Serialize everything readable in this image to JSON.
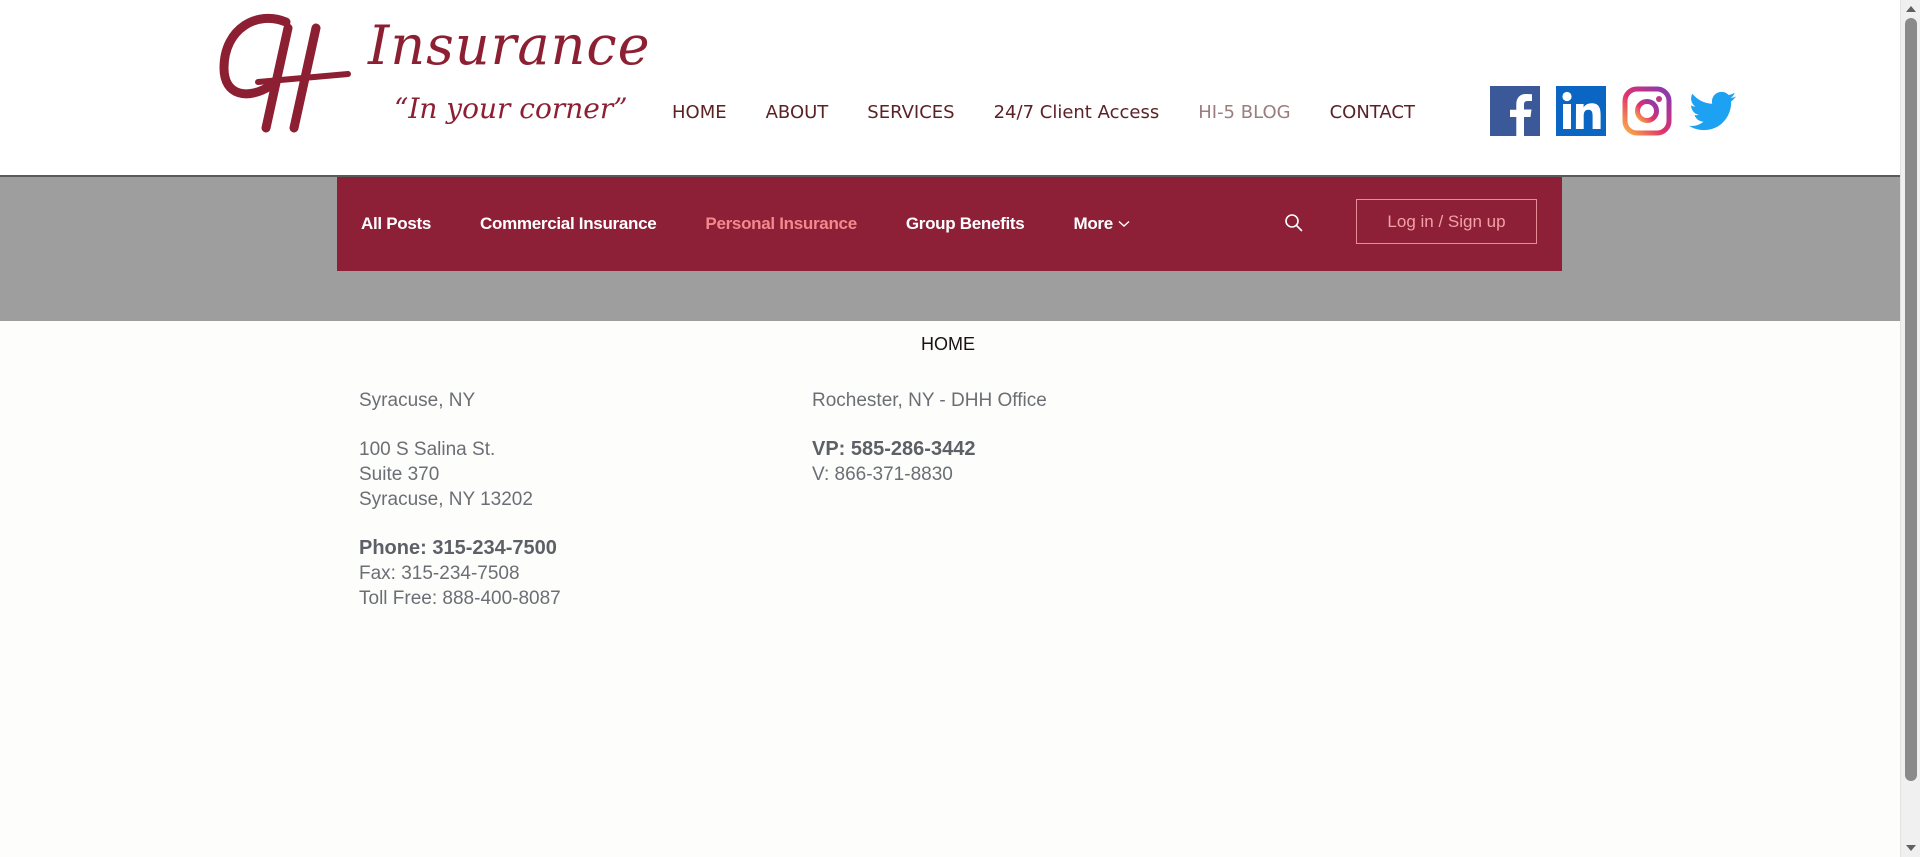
{
  "header": {
    "logo": {
      "monogram": "CH",
      "name": "Insurance",
      "tagline": "“In your corner”"
    },
    "nav": [
      {
        "label": "HOME"
      },
      {
        "label": "ABOUT"
      },
      {
        "label": "SERVICES"
      },
      {
        "label": "24/7 Client Access"
      },
      {
        "label": "HI-5 BLOG",
        "active": true
      },
      {
        "label": "CONTACT"
      }
    ],
    "social": [
      "facebook-icon",
      "linkedin-icon",
      "instagram-icon",
      "twitter-icon"
    ]
  },
  "blog_menu": {
    "items": [
      {
        "label": "All Posts"
      },
      {
        "label": "Commercial Insurance"
      },
      {
        "label": "Personal Insurance",
        "active": true
      },
      {
        "label": "Group Benefits"
      }
    ],
    "more_label": "More",
    "login_label": "Log in / Sign up"
  },
  "content": {
    "home_link": "HOME",
    "syracuse": {
      "title": "Syracuse, NY",
      "address": [
        "100 S Salina St.",
        "Suite 370",
        "Syracuse, NY 13202"
      ],
      "phone": "Phone: 315-234-7500",
      "fax": "Fax: 315-234-7508",
      "toll_free": "Toll Free: 888-400-8087"
    },
    "rochester": {
      "title": "Rochester, NY - DHH Office",
      "vp": "VP: 585-286-3442",
      "v": "V: 866-371-8830"
    }
  },
  "colors": {
    "brand": "#8d2036",
    "nav_text": "#5b2226",
    "active_blog_link": "#f3898c",
    "band_gray": "#9e9e9e"
  }
}
